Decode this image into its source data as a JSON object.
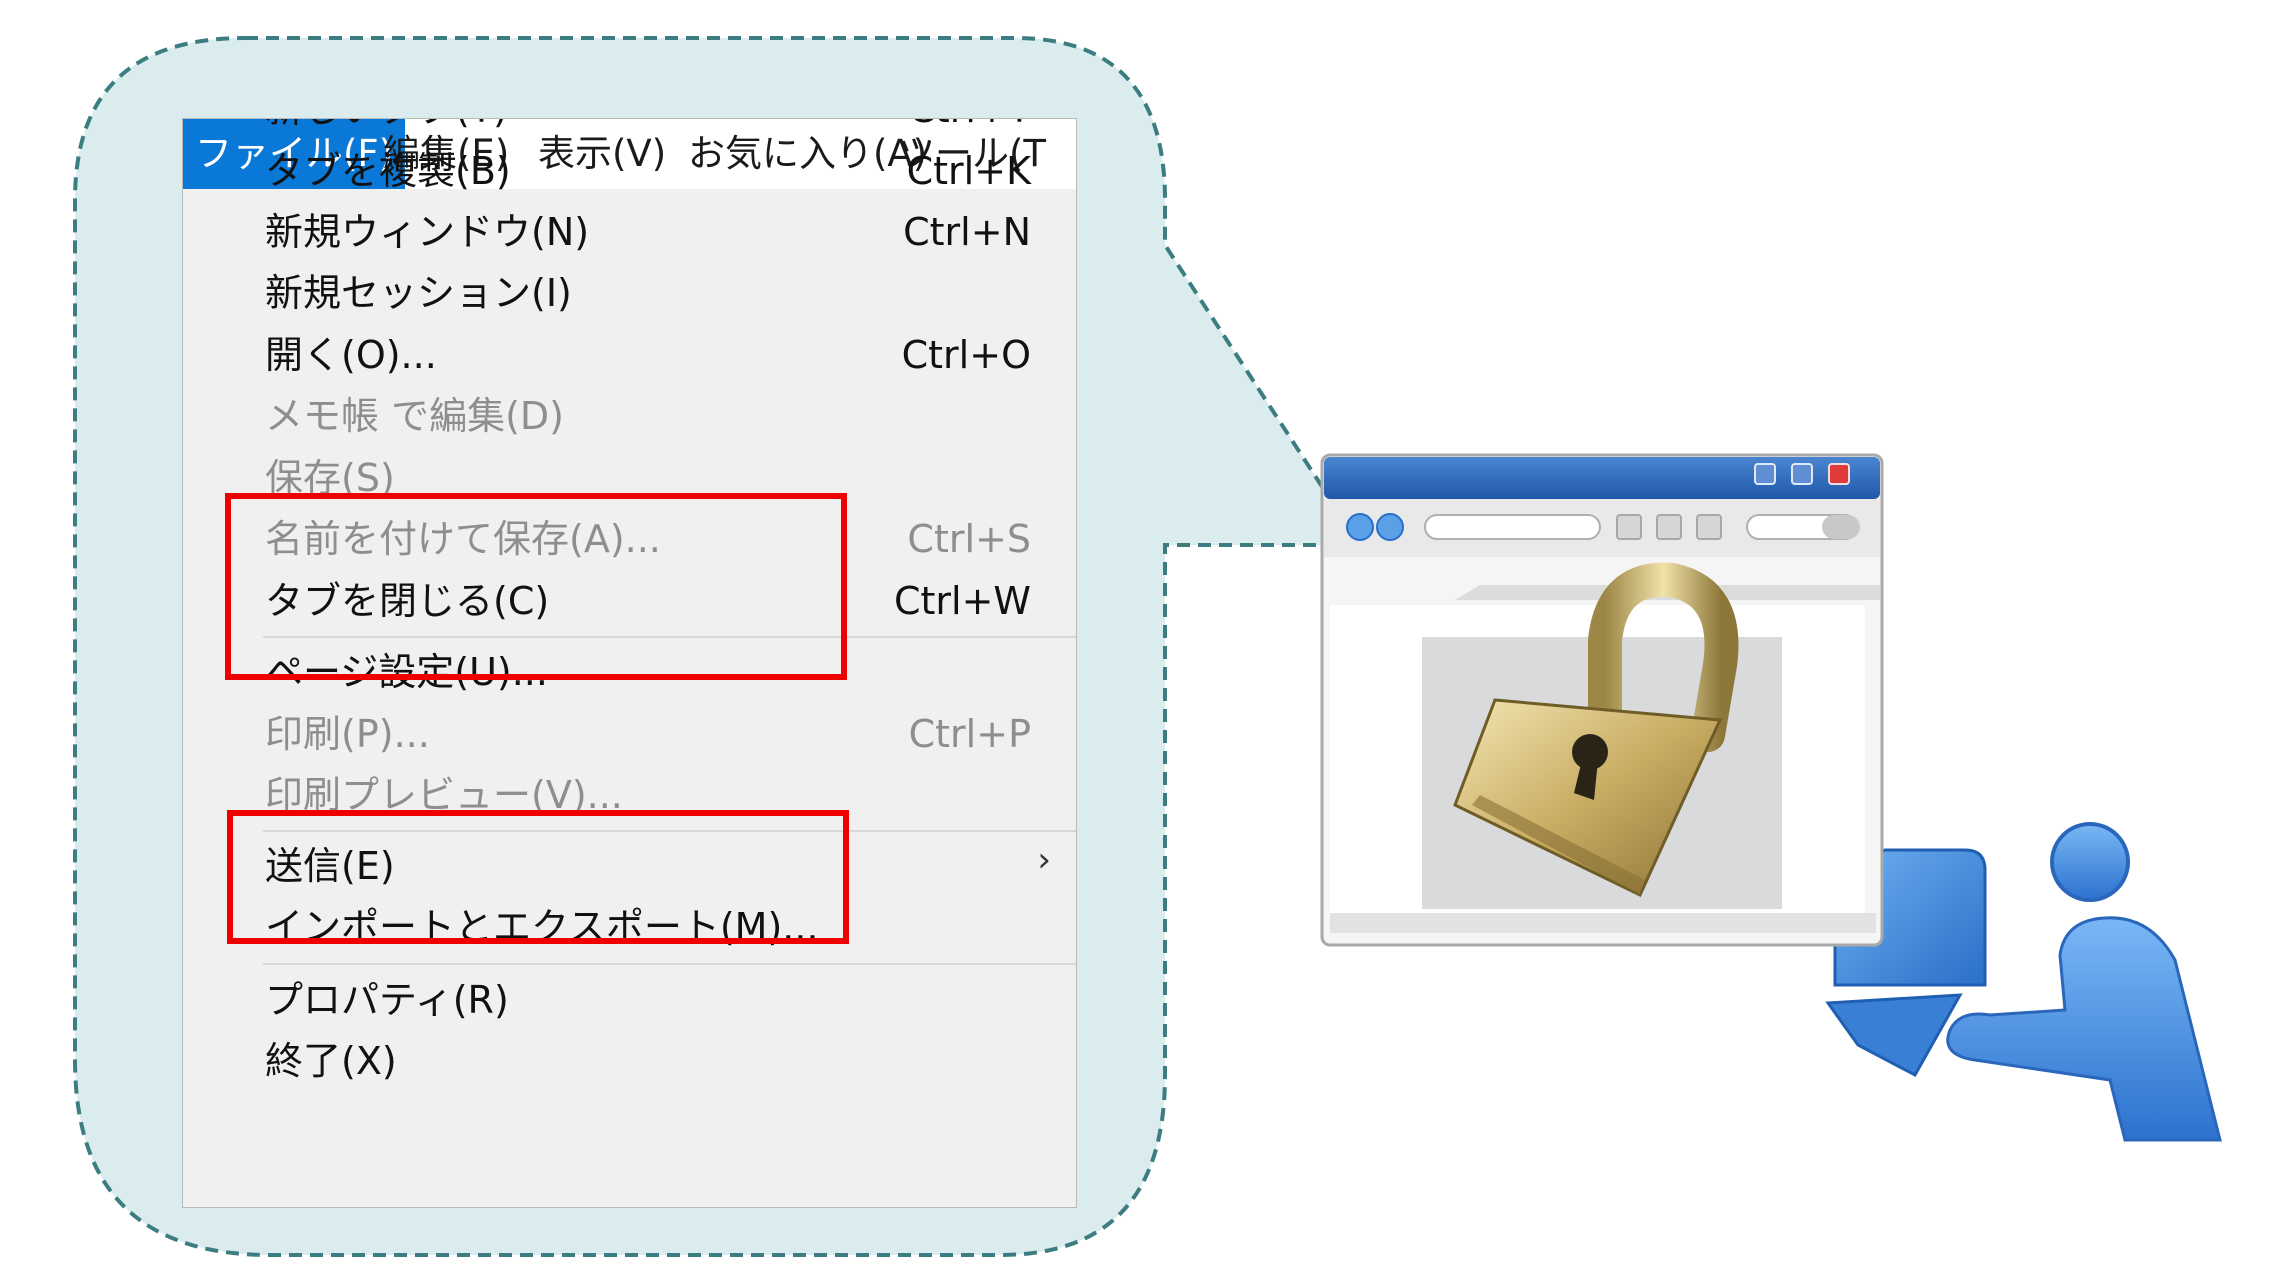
{
  "menubar": [
    {
      "label": "ファイル(F)",
      "active": true
    },
    {
      "label": "編集(E)"
    },
    {
      "label": "表示(V)"
    },
    {
      "label": "お気に入り(A)"
    },
    {
      "label": "ツール(T"
    }
  ],
  "file_menu": [
    {
      "label": "新しいタブ(T)",
      "shortcut": "Ctrl+T",
      "enabled": true
    },
    {
      "label": "タブを複製(B)",
      "shortcut": "Ctrl+K",
      "enabled": true
    },
    {
      "label": "新規ウィンドウ(N)",
      "shortcut": "Ctrl+N",
      "enabled": true
    },
    {
      "label": "新規セッション(I)",
      "shortcut": "",
      "enabled": true
    },
    {
      "label": "開く(O)...",
      "shortcut": "Ctrl+O",
      "enabled": true
    },
    {
      "label": "メモ帳 で編集(D)",
      "shortcut": "",
      "enabled": false
    },
    {
      "label": "保存(S)",
      "shortcut": "",
      "enabled": false
    },
    {
      "label": "名前を付けて保存(A)...",
      "shortcut": "Ctrl+S",
      "enabled": false
    },
    {
      "label": "タブを閉じる(C)",
      "shortcut": "Ctrl+W",
      "enabled": true
    },
    {
      "label": "ページ設定(U)...",
      "shortcut": "",
      "enabled": true
    },
    {
      "label": "印刷(P)...",
      "shortcut": "Ctrl+P",
      "enabled": false
    },
    {
      "label": "印刷プレビュー(V)...",
      "shortcut": "",
      "enabled": false
    },
    {
      "label": "送信(E)",
      "shortcut": "",
      "enabled": true,
      "submenu": true
    },
    {
      "label": "インポートとエクスポート(M)...",
      "shortcut": "",
      "enabled": true
    },
    {
      "label": "プロパティ(R)",
      "shortcut": "",
      "enabled": true
    },
    {
      "label": "終了(X)",
      "shortcut": "",
      "enabled": true
    }
  ],
  "submenu_glyph": "›",
  "colors": {
    "menubar_active": "#0a78d7",
    "highlight_box": "#ee0000",
    "callout_fill": "#daeced",
    "callout_stroke": "#3b7d80",
    "disabled_text": "#8e8e8e"
  },
  "icons": [
    "padlock-icon",
    "browser-window-icon",
    "user-at-computer-icon"
  ]
}
